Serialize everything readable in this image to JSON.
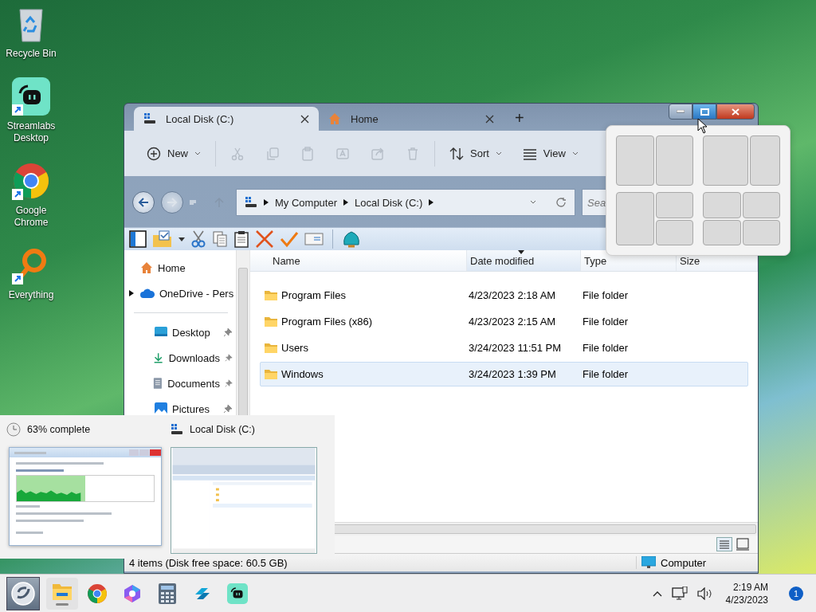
{
  "desktop_icons": [
    {
      "label": "Recycle Bin",
      "kind": "recycle-bin",
      "shortcut": false
    },
    {
      "label": "Streamlabs Desktop",
      "kind": "streamlabs",
      "shortcut": true
    },
    {
      "label": "Google Chrome",
      "kind": "chrome",
      "shortcut": true
    },
    {
      "label": "Everything",
      "kind": "everything",
      "shortcut": true
    }
  ],
  "explorer": {
    "tabs": [
      {
        "label": "Local Disk (C:)",
        "kind": "drive",
        "selected": true
      },
      {
        "label": "Home",
        "kind": "home",
        "selected": false
      }
    ],
    "new_tab": "+",
    "command_bar": [
      {
        "items": [
          {
            "label": "New",
            "kind": "new",
            "disabled": false
          }
        ]
      },
      {
        "items": [
          {
            "kind": "cut",
            "disabled": true
          },
          {
            "kind": "copy",
            "disabled": true
          },
          {
            "kind": "paste",
            "disabled": true
          },
          {
            "kind": "rename",
            "disabled": true
          },
          {
            "kind": "share",
            "disabled": true
          },
          {
            "kind": "delete",
            "disabled": true
          }
        ]
      },
      {
        "items": [
          {
            "label": "Sort",
            "kind": "sort",
            "disabled": false
          },
          {
            "label": "View",
            "kind": "view",
            "disabled": false
          }
        ]
      }
    ],
    "address": {
      "breadcrumbs": [
        "My Computer",
        "Local Disk (C:)"
      ],
      "search_placeholder": "Sea"
    },
    "sidebar": {
      "top": [
        {
          "label": "Home",
          "kind": "home",
          "pinned": false,
          "expandable": false
        },
        {
          "label": "OneDrive - Pers",
          "kind": "cloud",
          "pinned": false,
          "expandable": true
        }
      ],
      "quick_access": [
        {
          "label": "Desktop",
          "kind": "desktop",
          "pinned": true,
          "expandable": false
        },
        {
          "label": "Downloads",
          "kind": "downloads",
          "pinned": true,
          "expandable": false
        },
        {
          "label": "Documents",
          "kind": "documents",
          "pinned": true,
          "expandable": false
        },
        {
          "label": "Pictures",
          "kind": "pictures",
          "pinned": true,
          "expandable": false
        }
      ]
    },
    "columns": [
      {
        "label": "Name",
        "sorted": false
      },
      {
        "label": "Date modified",
        "sorted": true
      },
      {
        "label": "Type",
        "sorted": false
      },
      {
        "label": "Size",
        "sorted": false
      }
    ],
    "rows": [
      {
        "name": "Program Files",
        "date": "4/23/2023 2:18 AM",
        "type": "File folder",
        "selected": false
      },
      {
        "name": "Program Files (x86)",
        "date": "4/23/2023 2:15 AM",
        "type": "File folder",
        "selected": false
      },
      {
        "name": "Users",
        "date": "3/24/2023 11:51 PM",
        "type": "File folder",
        "selected": false
      },
      {
        "name": "Windows",
        "date": "3/24/2023 1:39 PM",
        "type": "File folder",
        "selected": true
      }
    ],
    "status_bar": {
      "summary": "4 items (Disk free space: 60.5 GB)",
      "location": "Computer"
    }
  },
  "taskbar_preview": [
    {
      "title": "63% complete",
      "kind": "progress",
      "dialog": {
        "level": 0.5
      }
    },
    {
      "title": "Local Disk (C:)",
      "kind": "explorer"
    }
  ],
  "taskbar": {
    "apps": [
      {
        "kind": "explorer",
        "running": true
      },
      {
        "kind": "chrome",
        "running": false
      },
      {
        "kind": "copilot",
        "running": false
      },
      {
        "kind": "calculator",
        "running": false
      },
      {
        "kind": "tiles",
        "running": false
      },
      {
        "kind": "streamlabs",
        "running": false
      }
    ],
    "clock": {
      "time": "2:19 AM",
      "date": "4/23/2023"
    },
    "notification_count": "1"
  }
}
